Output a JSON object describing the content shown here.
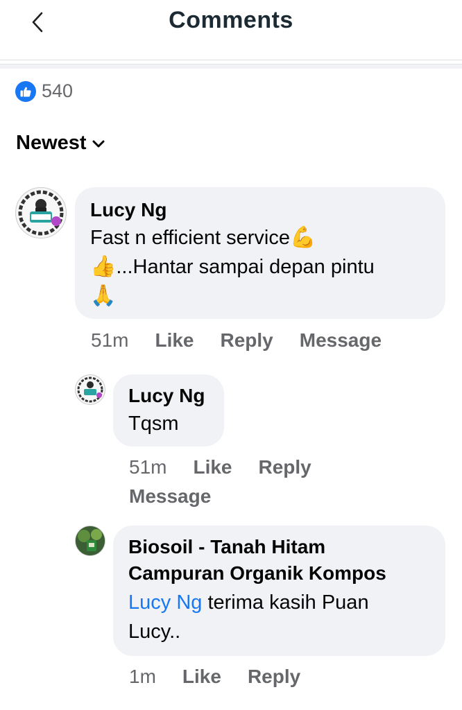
{
  "header": {
    "title": "Comments",
    "back_icon": "chevron-left-icon"
  },
  "reactions": {
    "icon": "thumbs-up-icon",
    "count": "540"
  },
  "sort": {
    "label": "Newest",
    "icon": "chevron-down-icon"
  },
  "comments": [
    {
      "author": "Lucy Ng",
      "text_line1": "Fast n efficient service",
      "emoji1": "💪",
      "emoji2": "👍",
      "text_line2": "...Hantar sampai depan pintu",
      "emoji3": "🙏",
      "time": "51m",
      "actions": [
        "Like",
        "Reply",
        "Message"
      ],
      "replies": [
        {
          "author": "Lucy Ng",
          "text": "Tqsm",
          "time": "51m",
          "actions": [
            "Like",
            "Reply",
            "Message"
          ]
        },
        {
          "author": "Biosoil - Tanah Hitam Campuran Organik Kompos",
          "author_line1": "Biosoil - Tanah Hitam",
          "author_line2": "Campuran Organik Kompos",
          "mention": "Lucy Ng",
          "text_line1": "terima kasih Puan",
          "text_line2": "Lucy..",
          "time": "1m",
          "actions": [
            "Like",
            "Reply"
          ]
        }
      ]
    }
  ],
  "colors": {
    "link": "#1877f2",
    "bubble": "#f0f2f5",
    "meta": "#65676b"
  }
}
